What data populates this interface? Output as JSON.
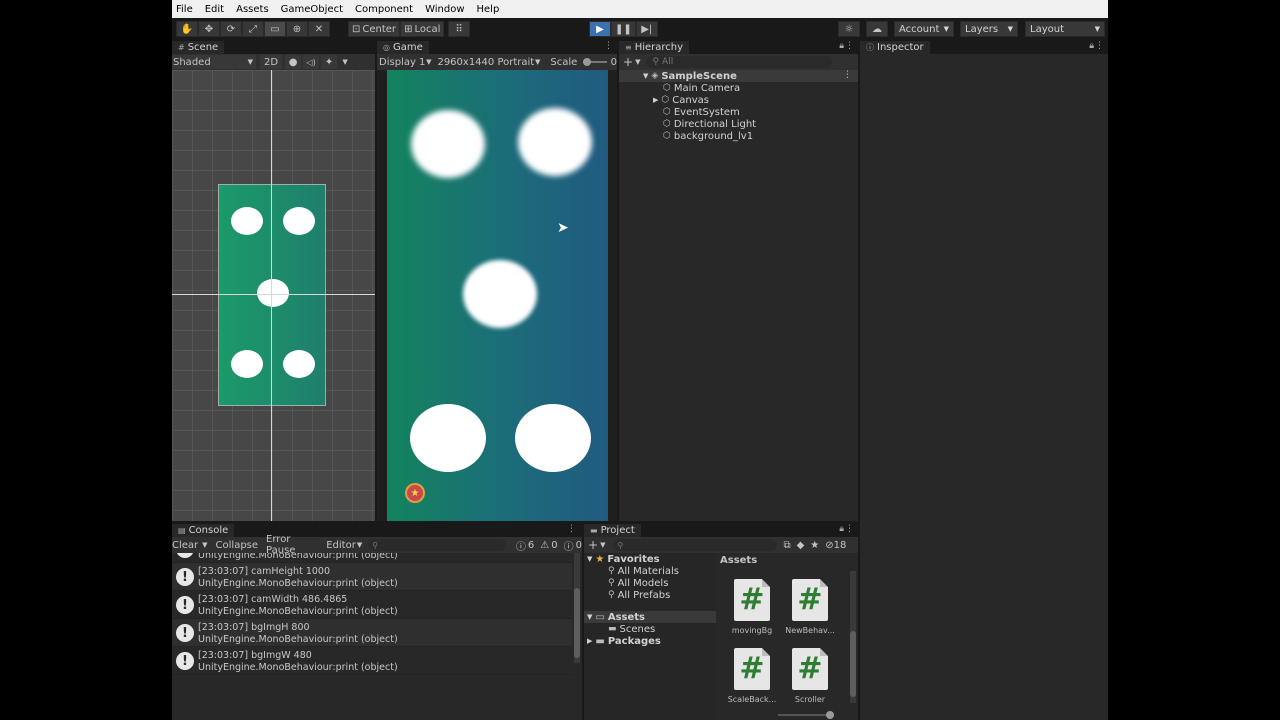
{
  "menu": [
    "File",
    "Edit",
    "Assets",
    "GameObject",
    "Component",
    "Window",
    "Help"
  ],
  "toolbar": {
    "center_label": "Center",
    "local_label": "Local",
    "account_label": "Account",
    "layers_label": "Layers",
    "layout_label": "Layout"
  },
  "scene": {
    "tab_label": "Scene",
    "shading": "Shaded",
    "mode_2d": "2D"
  },
  "game": {
    "tab_label": "Game",
    "display": "Display 1",
    "resolution": "2960x1440 Portrait",
    "scale_label": "Scale",
    "scale_value": "0"
  },
  "hierarchy": {
    "tab_label": "Hierarchy",
    "search_placeholder": "All",
    "scene_name": "SampleScene",
    "items": [
      "Main Camera",
      "Canvas",
      "EventSystem",
      "Directional Light",
      "background_lv1"
    ]
  },
  "inspector": {
    "tab_label": "Inspector"
  },
  "console": {
    "tab_label": "Console",
    "clear": "Clear",
    "collapse": "Collapse",
    "error_pause": "Error Pause",
    "editor": "Editor",
    "count_info": "6",
    "count_warn": "0",
    "count_error": "0",
    "partial_top": "UnityEngine.MonoBehaviour:print (object)",
    "entries": [
      {
        "msg": "[23:03:07] camHeight 1000",
        "trace": "UnityEngine.MonoBehaviour:print (object)"
      },
      {
        "msg": "[23:03:07] camWidth 486.4865",
        "trace": "UnityEngine.MonoBehaviour:print (object)"
      },
      {
        "msg": "[23:03:07] bgImgH 800",
        "trace": "UnityEngine.MonoBehaviour:print (object)"
      },
      {
        "msg": "[23:03:07] bgImgW 480",
        "trace": "UnityEngine.MonoBehaviour:print (object)"
      }
    ]
  },
  "project": {
    "tab_label": "Project",
    "hidden_count": "18",
    "favorites": "Favorites",
    "fav_items": [
      "All Materials",
      "All Models",
      "All Prefabs"
    ],
    "assets_folder": "Assets",
    "scenes_folder": "Scenes",
    "packages_folder": "Packages",
    "assets_header": "Assets",
    "asset_files": [
      "movingBg",
      "NewBehav...",
      "ScaleBack...",
      "Scroller"
    ]
  },
  "colors": {
    "play_blue": "#3a72b0",
    "game_green": "#13845e",
    "game_blue": "#215a80",
    "script_green": "#2f7d32"
  }
}
